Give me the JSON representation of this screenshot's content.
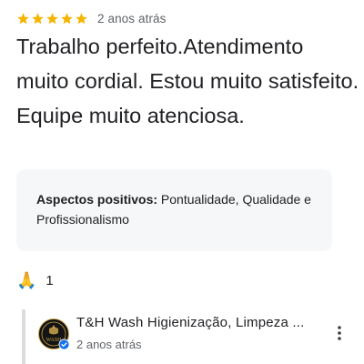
{
  "review": {
    "rating": 5,
    "max_rating": 5,
    "star_color": "#f4b400",
    "time": "2 anos atrás",
    "text": "Trabalho perfeito.Atendimento muito cordial. Estou muito satisfeito. Equipe muito atenciosa.",
    "aspects": {
      "label": "Aspectos positivos:",
      "value": " Pontualidade, Qualidade e Profissionalismo"
    },
    "reaction": {
      "icon": "folded-hands-icon",
      "glyph": "🙏",
      "count": "1"
    }
  },
  "owner_reply": {
    "name": "T&H Wash Higienização, Limpeza ...",
    "time": "2 anos atrás",
    "avatar_icon": "wash-logo-icon",
    "avatar_logo_text": "WASH",
    "verified_icon": "verified-badge-icon",
    "verified_color": "#1a73e8",
    "more_icon": "more-vertical-icon"
  }
}
